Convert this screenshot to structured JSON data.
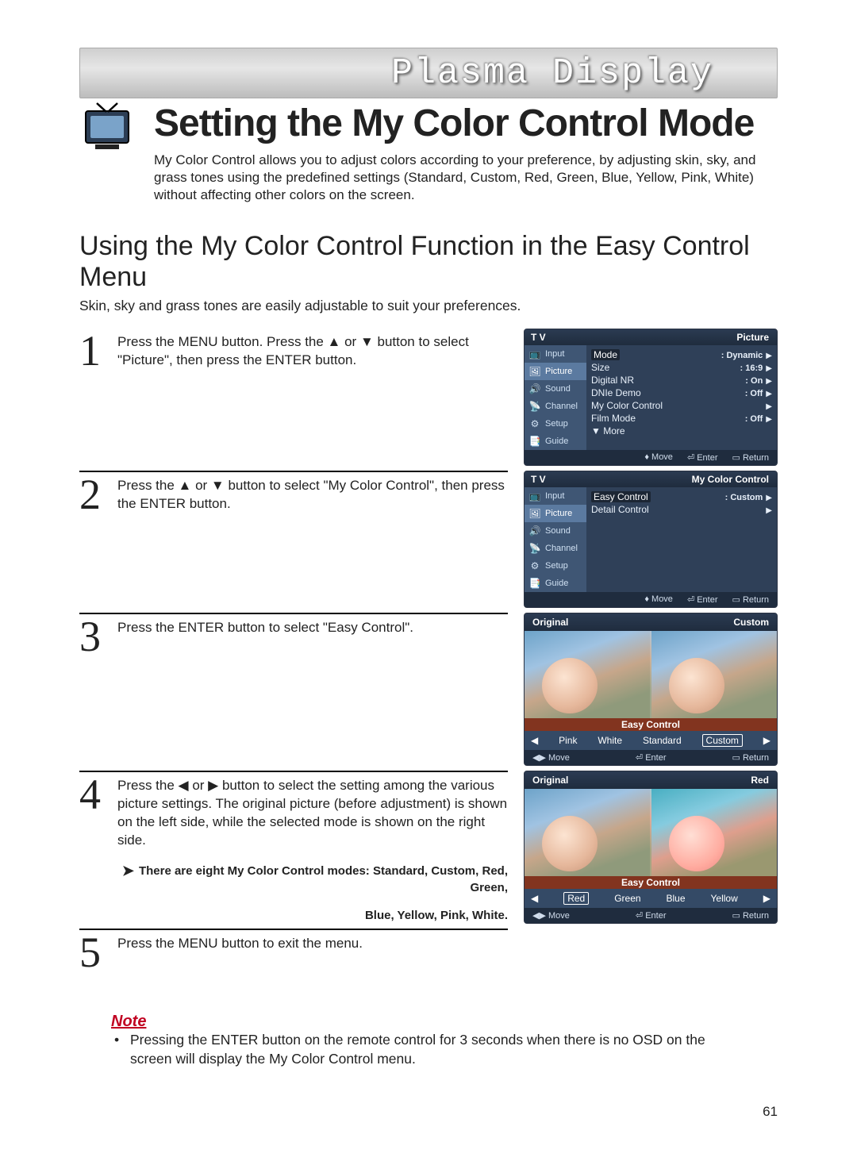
{
  "banner": {
    "text": "Plasma Display"
  },
  "title": "Setting the My Color Control Mode",
  "intro": "My Color Control allows you to adjust colors according to your preference, by adjusting skin, sky, and grass tones using the predefined settings (Standard, Custom, Red, Green, Blue, Yellow, Pink, White) without affecting other colors on the screen.",
  "subtitle": "Using the My Color Control Function in the Easy Control Menu",
  "subintro": "Skin, sky and grass tones are easily adjustable to suit your preferences.",
  "steps": {
    "s1": {
      "num": "1",
      "text": "Press the MENU button. Press the ▲ or ▼ button to select \"Picture\", then press the ENTER button."
    },
    "s2": {
      "num": "2",
      "text": "Press the ▲ or ▼ button to select \"My Color Control\", then press the ENTER button."
    },
    "s3": {
      "num": "3",
      "text": "Press the ENTER button to select \"Easy Control\"."
    },
    "s4": {
      "num": "4",
      "text": "Press the ◀ or ▶ button to select the setting among the various picture settings. The original picture (before adjustment) is shown on the left side, while the selected mode is shown on the right side.",
      "note1": "There are eight My Color Control modes: Standard, Custom, Red, Green,",
      "note2": "Blue, Yellow, Pink, White."
    },
    "s5": {
      "num": "5",
      "text": "Press the MENU button to exit the menu."
    }
  },
  "osd_common": {
    "tv": "T V",
    "left_items": [
      "Input",
      "Picture",
      "Sound",
      "Channel",
      "Setup",
      "Guide"
    ],
    "foot_move_ud": "Move",
    "foot_move_lr": "Move",
    "foot_enter": "Enter",
    "foot_return": "Return"
  },
  "osd1": {
    "title": "Picture",
    "rows": [
      {
        "k": "Mode",
        "v": ": Dynamic",
        "hl": true
      },
      {
        "k": "Size",
        "v": ": 16:9"
      },
      {
        "k": "Digital NR",
        "v": ": On"
      },
      {
        "k": "DNIe Demo",
        "v": ": Off"
      },
      {
        "k": "My Color Control",
        "v": ""
      },
      {
        "k": "Film Mode",
        "v": ": Off"
      },
      {
        "k": "▼ More",
        "v": ""
      }
    ]
  },
  "osd2": {
    "title": "My Color Control",
    "rows": [
      {
        "k": "Easy Control",
        "v": ": Custom",
        "hl": true
      },
      {
        "k": "Detail Control",
        "v": ""
      }
    ]
  },
  "osd3": {
    "left_label": "Original",
    "right_label": "Custom",
    "bar_title": "Easy Control",
    "opts": [
      "Pink",
      "White",
      "Standard",
      "Custom"
    ],
    "sel": "Custom"
  },
  "osd4": {
    "left_label": "Original",
    "right_label": "Red",
    "bar_title": "Easy Control",
    "opts": [
      "Red",
      "Green",
      "Blue",
      "Yellow"
    ],
    "sel": "Red"
  },
  "note": {
    "head": "Note",
    "body": "Pressing the ENTER button on the remote control for 3 seconds when there is no OSD on the screen will display the My Color Control menu."
  },
  "page_number": "61"
}
